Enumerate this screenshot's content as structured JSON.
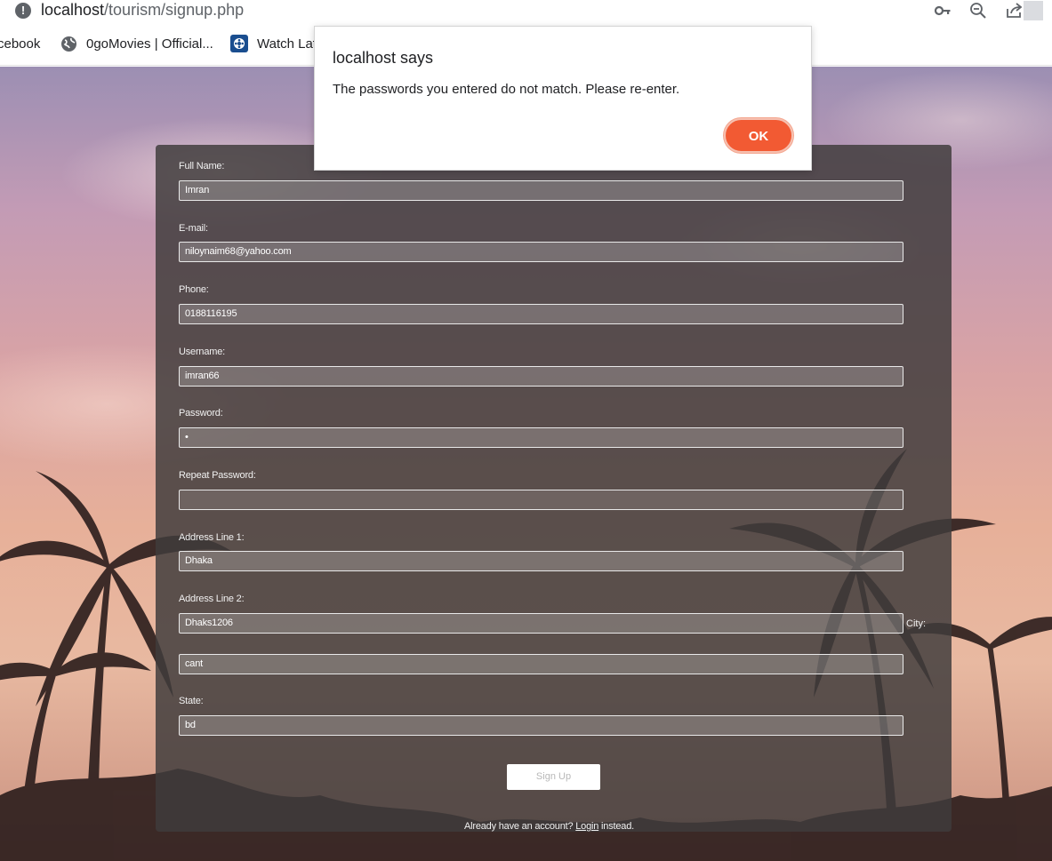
{
  "browser": {
    "url_host": "localhost",
    "url_path": "/tourism/signup.php",
    "bookmarks": [
      {
        "label": "cebook"
      },
      {
        "label": "0goMovies | Official..."
      },
      {
        "label": "Watch Lat"
      }
    ]
  },
  "dialog": {
    "title": "localhost says",
    "message": "The passwords you entered do not match. Please re-enter.",
    "ok_label": "OK",
    "ok_color": "#f25a33"
  },
  "form": {
    "full_name_label": "Full Name:",
    "full_name_value": "Imran",
    "email_label": "E-mail:",
    "email_value": "niloynaim68@yahoo.com",
    "phone_label": "Phone:",
    "phone_value": "0188116195",
    "username_label": "Username:",
    "username_value": "imran66",
    "password_label": "Password:",
    "password_value": "•",
    "repeat_password_label": "Repeat Password:",
    "repeat_password_value": "",
    "address1_label": "Address Line 1:",
    "address1_value": "Dhaka",
    "address2_label": "Address Line 2:",
    "address2_value": "Dhaks1206",
    "city_label": "City:",
    "city_value": "cant",
    "state_label": "State:",
    "state_value": "bd",
    "signup_label": "Sign Up",
    "already_text": "Already have an account?",
    "login_link": "Login",
    "instead_text": "instead."
  }
}
